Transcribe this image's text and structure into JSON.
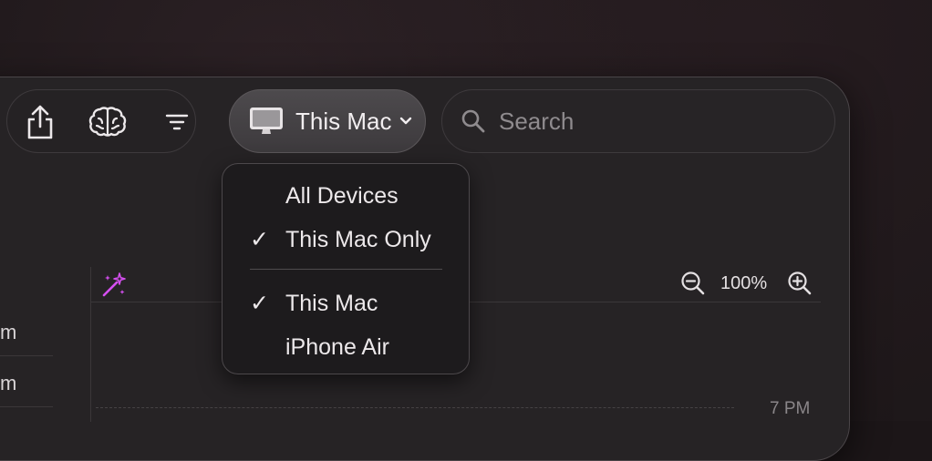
{
  "toolbar": {
    "share_icon": "share-icon",
    "brain_icon": "brain-icon",
    "filter_icon": "filter-icon"
  },
  "device_selector": {
    "icon": "monitor-icon",
    "label": "This Mac"
  },
  "search": {
    "placeholder": "Search"
  },
  "device_menu": {
    "items": [
      {
        "label": "All Devices",
        "checked": false
      },
      {
        "label": "This Mac Only",
        "checked": true
      },
      {
        "label": "This Mac",
        "checked": true
      },
      {
        "label": "iPhone Air",
        "checked": false
      }
    ],
    "check_glyph": "✓"
  },
  "timeline": {
    "magic_icon": "magic-wand-icon",
    "zoom_level": "100%",
    "time_label": "7 PM"
  },
  "sidebar": {
    "rows": [
      "m",
      "m"
    ]
  },
  "colors": {
    "accent_magic": "#d54ff0"
  }
}
